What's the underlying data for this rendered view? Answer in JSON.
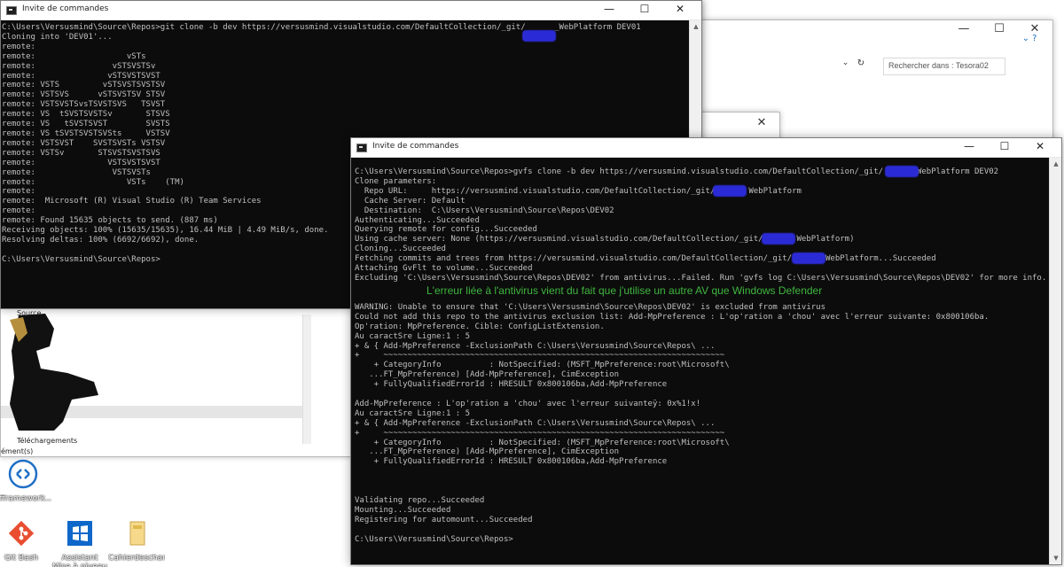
{
  "console1": {
    "title": "Invite de commandes",
    "lines": "C:\\Users\\Versusmind\\Source\\Repos>git clone -b dev https://versusmind.visualstudio.com/DefaultCollection/_git/      _WebPlatform DEV01\nCloning into 'DEV01'...\nremote:\nremote:                   vSTs\nremote:                vSTSVSTSv\nremote:               vSTSVSTSVST\nremote: VSTS         vSTSVSTSVSTSV\nremote: VSTSVS      vSTSVSTSV STSV\nremote: VSTSVSTSvsTSVSTSVS   TSVST\nremote: VS  tSVSTSVSTSv       STSVS\nremote: VS   tSVSTSVST        SVSTS\nremote: VS tSVSTSVSTSVSts     VSTSV\nremote: VSTSVST    SVSTSVSTs VSTSV\nremote: VSTSv       STSVSTSVSTSVS\nremote:               VSTSVSTSVST\nremote:                VSTSVSTs\nremote:                   VSTs    (TM)\nremote:\nremote:  Microsoft (R) Visual Studio (R) Team Services\nremote:\nremote: Found 15635 objects to send. (887 ms)\nReceiving objects: 100% (15635/15635), 16.44 MiB | 4.49 MiB/s, done.\nResolving deltas: 100% (6692/6692), done.\n\nC:\\Users\\Versusmind\\Source\\Repos>"
  },
  "console2": {
    "title": "Invite de commandes",
    "lines_top": "C:\\Users\\Versusmind\\Source\\Repos>gvfs clone -b dev https://versusmind.visualstudio.com/DefaultCollection/_git/       WebPlatform DEV02\nClone parameters:\n  Repo URL:     https://versusmind.visualstudio.com/DefaultCollection/_git/       WebPlatform\n  Cache Server: Default\n  Destination:  C:\\Users\\Versusmind\\Source\\Repos\\DEV02\nAuthenticating...Succeeded\nQuerying remote for config...Succeeded\nUsing cache server: None (https://versusmind.visualstudio.com/DefaultCollection/_git/       WebPlatform)\nCloning...Succeeded\nFetching commits and trees from https://versusmind.visualstudio.com/DefaultCollection/_git/       WebPlatform...Succeeded\nAttaching GvFlt to volume...Succeeded\nExcluding 'C:\\Users\\Versusmind\\Source\\Repos\\DEV02' from antivirus...Failed. Run 'gvfs log C:\\Users\\Versusmind\\Source\\Repos\\DEV02' for more info.",
    "lines_bottom": "WARNING: Unable to ensure that 'C:\\Users\\Versusmind\\Source\\Repos\\DEV02' is excluded from antivirus\nCould not add this repo to the antivirus exclusion list: Add-MpPreference : L'op'ration a 'chou' avec l'erreur suivante: 0x800106ba.\nOp'ration: MpPreference. Cible: ConfigListExtension.\nAu caractSre Ligne:1 : 5\n+ & { Add-MpPreference -ExclusionPath C:\\Users\\Versusmind\\Source\\Repos\\ ...\n+     ~~~~~~~~~~~~~~~~~~~~~~~~~~~~~~~~~~~~~~~~~~~~~~~~~~~~~~~~~~~~~~~~~~~~~~~\n    + CategoryInfo          : NotSpecified: (MSFT_MpPreference:root\\Microsoft\\\n   ...FT_MpPreference) [Add-MpPreference], CimException\n    + FullyQualifiedErrorId : HRESULT 0x800106ba,Add-MpPreference\n\nAdd-MpPreference : L'op'ration a 'chou' avec l'erreur suivanteÿ: 0x%1!x!\nAu caractSre Ligne:1 : 5\n+ & { Add-MpPreference -ExclusionPath C:\\Users\\Versusmind\\Source\\Repos\\ ...\n+     ~~~~~~~~~~~~~~~~~~~~~~~~~~~~~~~~~~~~~~~~~~~~~~~~~~~~~~~~~~~~~~~~~~~~~~~\n    + CategoryInfo          : NotSpecified: (MSFT_MpPreference:root\\Microsoft\\\n   ...FT_MpPreference) [Add-MpPreference], CimException\n    + FullyQualifiedErrorId : HRESULT 0x800106ba,Add-MpPreference\n\n\n\nValidating repo...Succeeded\nMounting...Succeeded\nRegistering for automount...Succeeded\n\nC:\\Users\\Versusmind\\Source\\Repos>",
    "annotation": "L'erreur liée à l'antivirus vient du fait que j'utilise un autre AV que Windows Defender"
  },
  "explorer": {
    "search_placeholder": "Rechercher dans : Tesora02",
    "nav_source": "Source",
    "nav_downloads": "Téléchargements",
    "status_elements": "ément(s)"
  },
  "desktop_icons": [
    {
      "label": "offramework...",
      "icon": "network-icon"
    },
    {
      "label": "Git Bash",
      "icon": "git-icon"
    },
    {
      "label": "Assistant Mise à niveau de Win...",
      "icon": "windows-icon"
    },
    {
      "label": "Cahierdescharg...",
      "icon": "folder-icon"
    }
  ],
  "colors": {
    "console_bg": "#0c0c0c",
    "console_text": "#c0c0c0",
    "annotation": "#3fb63f",
    "redaction": "#2b2bd6"
  }
}
